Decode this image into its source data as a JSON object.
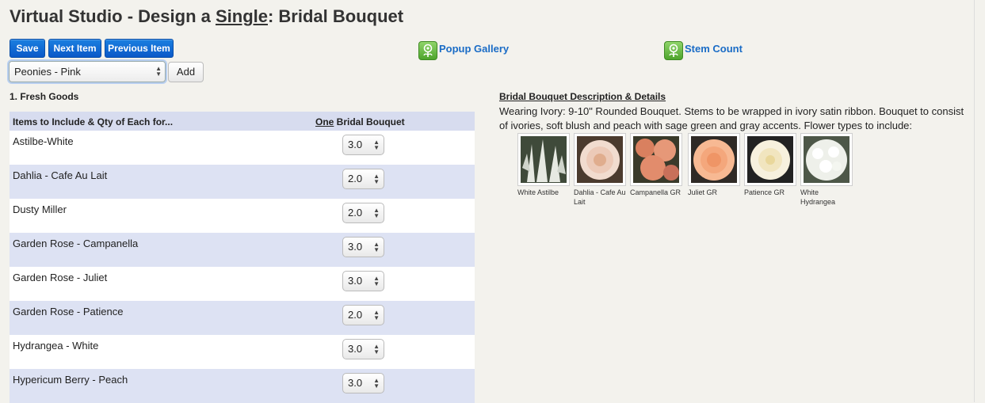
{
  "page": {
    "title_prefix": "Virtual Studio - Design a ",
    "title_single": "Single",
    "title_suffix": ": Bridal Bouquet"
  },
  "toolbar": {
    "save_label": "Save",
    "next_label": "Next Item",
    "previous_label": "Previous Item",
    "select_value": "Peonies - Pink",
    "add_label": "Add",
    "popup_gallery_label": "Popup Gallery",
    "stem_count_label": "Stem Count"
  },
  "section": {
    "label": "1. Fresh Goods",
    "col1_header": "Items to Include & Qty of Each for...",
    "col2_header_one": "One",
    "col2_header_rest": " Bridal Bouquet"
  },
  "items": [
    {
      "name": "Astilbe-White",
      "qty": "3.0"
    },
    {
      "name": "Dahlia - Cafe Au Lait",
      "qty": "2.0"
    },
    {
      "name": "Dusty Miller",
      "qty": "2.0"
    },
    {
      "name": "Garden Rose - Campanella",
      "qty": "3.0"
    },
    {
      "name": "Garden Rose - Juliet",
      "qty": "3.0"
    },
    {
      "name": "Garden Rose - Patience",
      "qty": "2.0"
    },
    {
      "name": "Hydrangea - White",
      "qty": "3.0"
    },
    {
      "name": "Hypericum Berry - Peach",
      "qty": "3.0"
    }
  ],
  "description": {
    "title": "Bridal Bouquet Description & Details",
    "text": "Wearing Ivory: 9-10\" Rounded Bouquet. Stems to be wrapped in ivory satin ribbon. Bouquet to consist of ivories, soft blush and peach with sage green and gray accents. Flower types to include:"
  },
  "thumbnails": [
    {
      "caption": "White Astilbe",
      "color": "#dfe3dc"
    },
    {
      "caption": "Dahlia - Cafe Au Lait",
      "color": "#efd6cc"
    },
    {
      "caption": "Campanella GR",
      "color": "#e49a7e"
    },
    {
      "caption": "Juliet GR",
      "color": "#f5b48c"
    },
    {
      "caption": "Patience GR",
      "color": "#f6efd9"
    },
    {
      "caption": "White Hydrangea",
      "color": "#eef0ea"
    }
  ],
  "colors": {
    "accent_blue": "#0b59c8",
    "link_blue": "#1a6cc6",
    "row_alt": "#dde2f3",
    "header_bg": "#d7dcef",
    "icon_green": "#5cb338"
  }
}
